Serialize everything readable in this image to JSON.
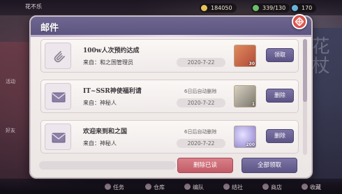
{
  "hud": {
    "player_name": "花不乐",
    "stats": [
      {
        "name": "gold",
        "value": "184050",
        "color": "#e8c45a"
      },
      {
        "name": "stamina",
        "value": "339/130",
        "color": "#6cc06a"
      },
      {
        "name": "jade",
        "value": "170",
        "color": "#68b4d8"
      }
    ]
  },
  "modal": {
    "title": "邮件",
    "mails": [
      {
        "title": "100w人次预约达成",
        "from": "来自：和之国管理员",
        "auto_delete": "",
        "date": "2020-7-22",
        "reward_qty": "30",
        "reward_color": "#c85a3a",
        "action": "领取",
        "icon": "paperclip-icon"
      },
      {
        "title": "IT~SSR神使福利请",
        "from": "来自：神秘人",
        "auto_delete": "6日后自动删除",
        "date": "2020-7-22",
        "reward_qty": "1",
        "reward_color": "#8a8a8a",
        "action": "删除",
        "icon": "envelope-icon"
      },
      {
        "title": "欢迎来到和之国",
        "from": "来自：神秘人",
        "auto_delete": "6日后自动删除",
        "date": "2020-7-22",
        "reward_qty": "200",
        "reward_color": "#9a8ed8",
        "action": "删除",
        "icon": "envelope-icon"
      }
    ],
    "delete_read_label": "删除已读",
    "claim_all_label": "全部领取"
  },
  "bottom_bar": {
    "items": [
      "任务",
      "仓库",
      "编队",
      "结社",
      "商店",
      "收藏"
    ]
  },
  "side": {
    "left_labels": [
      "活动",
      "好友"
    ],
    "right_label": "花杖"
  }
}
